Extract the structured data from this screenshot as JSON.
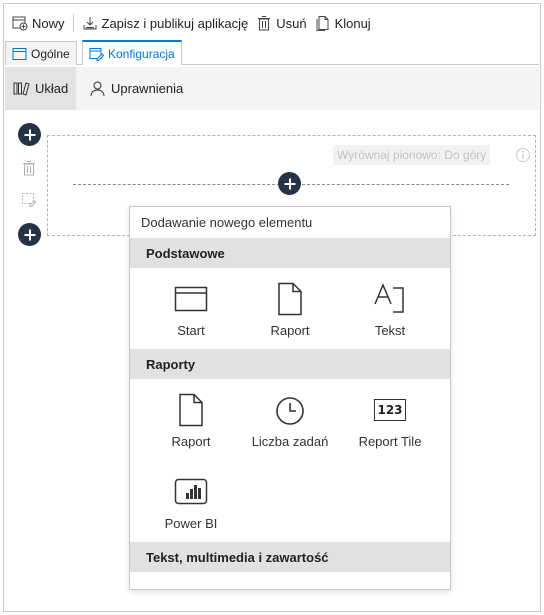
{
  "toolbar": {
    "new_label": "Nowy",
    "save_publish_label": "Zapisz i publikuj aplikację",
    "delete_label": "Usuń",
    "clone_label": "Klonuj"
  },
  "tabs": [
    {
      "label": "Ogólne",
      "icon": "window-icon",
      "active": false
    },
    {
      "label": "Konfiguracja",
      "icon": "edit-window-icon",
      "active": true
    }
  ],
  "subnav": [
    {
      "label": "Układ",
      "icon": "layout-columns-icon",
      "active": true
    },
    {
      "label": "Uprawnienia",
      "icon": "person-icon",
      "active": false
    }
  ],
  "section": {
    "vertical_align_label": "Wyrównaj pionowo: Do góry"
  },
  "popup": {
    "title": "Dodawanie nowego elementu",
    "groups": [
      {
        "header": "Podstawowe",
        "items": [
          {
            "label": "Start",
            "icon": "window-icon"
          },
          {
            "label": "Raport",
            "icon": "document-icon"
          },
          {
            "label": "Tekst",
            "icon": "text-icon"
          }
        ]
      },
      {
        "header": "Raporty",
        "items": [
          {
            "label": "Raport",
            "icon": "document-icon"
          },
          {
            "label": "Liczba zadań",
            "icon": "clock-icon"
          },
          {
            "label": "Report Tile",
            "icon": "number-tile-icon",
            "glyph": "123"
          },
          {
            "label": "Power BI",
            "icon": "power-bi-icon"
          }
        ]
      },
      {
        "header": "Tekst, multimedia i zawartość",
        "items": []
      }
    ]
  },
  "colors": {
    "accent": "#0078d4",
    "round_button": "#253444",
    "group_header_bg": "#e1e1e1"
  }
}
